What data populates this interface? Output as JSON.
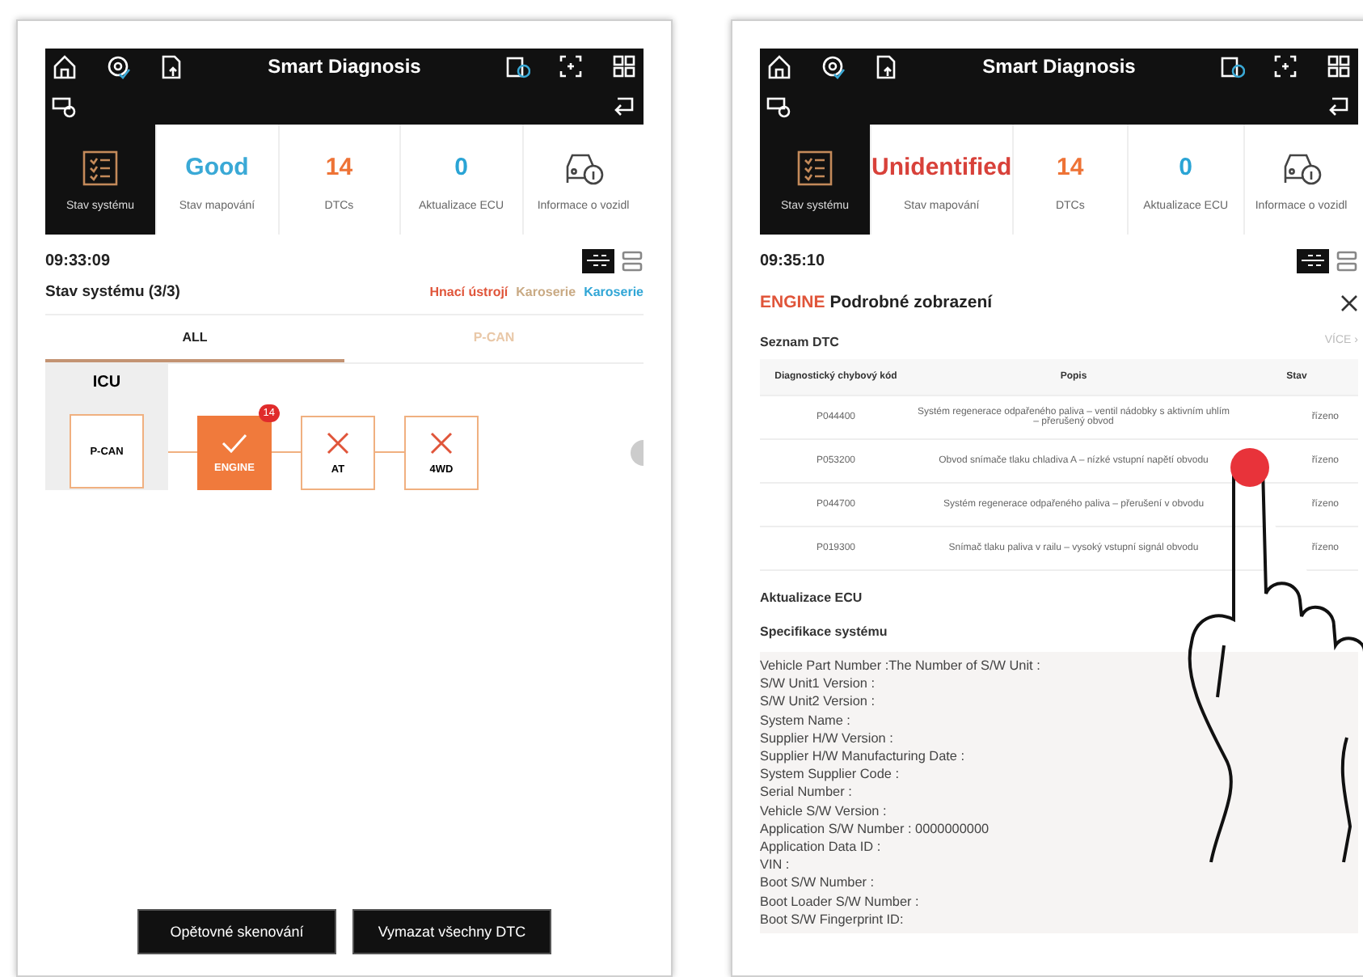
{
  "screens": [
    {
      "header": {
        "title": "Smart Diagnosis"
      },
      "stats": [
        {
          "kind": "icon",
          "label": "Stav systému",
          "selected": true
        },
        {
          "kind": "value",
          "value": "Good",
          "color": "#3aa9d6",
          "label": "Stav mapování",
          "selected": false
        },
        {
          "kind": "value",
          "value": "14",
          "color": "#ee7336",
          "label": "DTCs",
          "selected": false
        },
        {
          "kind": "value",
          "value": "0",
          "color": "#2aa4d5",
          "label": "Aktualizace ECU",
          "selected": false
        },
        {
          "kind": "car",
          "label": "Informace o vozidl",
          "selected": false
        }
      ],
      "time": "09:33:09",
      "system_status": {
        "title": "Stav systému (3/3)",
        "legend": [
          {
            "label": "Hnací ústrojí",
            "color": "#e0553a"
          },
          {
            "label": "Karoserie",
            "color": "#c9aa84"
          },
          {
            "label": "Karoserie",
            "color": "#31a6d6"
          }
        ]
      },
      "tabs": [
        {
          "label": "ALL",
          "selected": true
        },
        {
          "label": "P-CAN",
          "selected": false
        }
      ],
      "topology": {
        "gateway": "ICU",
        "bus": "P-CAN",
        "modules": [
          {
            "label": "ENGINE",
            "kind": "ok",
            "badge": "14"
          },
          {
            "label": "AT",
            "kind": "fail"
          },
          {
            "label": "4WD",
            "kind": "fail"
          }
        ]
      },
      "buttons": [
        "Opětovné skenování",
        "Vymazat všechny DTC"
      ]
    },
    {
      "header": {
        "title": "Smart Diagnosis"
      },
      "stats": [
        {
          "kind": "icon",
          "label": "Stav systému",
          "selected": true
        },
        {
          "kind": "value",
          "value": "Unidentified",
          "color": "#d8413a",
          "label": "Stav mapování",
          "selected": false
        },
        {
          "kind": "value",
          "value": "14",
          "color": "#ee7336",
          "label": "DTCs",
          "selected": false
        },
        {
          "kind": "value",
          "value": "0",
          "color": "#2aa4d5",
          "label": "Aktualizace ECU",
          "selected": false
        },
        {
          "kind": "car",
          "label": "Informace o vozidl",
          "selected": false
        }
      ],
      "time": "09:35:10",
      "detail": {
        "module": "ENGINE",
        "title": "Podrobné zobrazení",
        "dtc_heading": "Seznam DTC",
        "more": "VÍCE ›",
        "columns": [
          "Diagnostický chybový kód",
          "Popis",
          "Stav"
        ],
        "rows": [
          {
            "code": "P044400",
            "description": "Systém regenerace odpařeného paliva – ventil nádobky s aktivním uhlím – přerušený obvod",
            "status": "řízeno"
          },
          {
            "code": "P053200",
            "description": "Obvod snímače tlaku chladiva A – nízké vstupní napětí obvodu",
            "status": "řízeno"
          },
          {
            "code": "P044700",
            "description": "Systém regenerace odpařeného paliva – přerušení v obvodu",
            "status": "řízeno"
          },
          {
            "code": "P019300",
            "description": "Snímač tlaku paliva v railu – vysoký vstupní signál obvodu",
            "status": "řízeno"
          }
        ],
        "ecu_heading": "Aktualizace ECU",
        "spec_heading": "Specifikace systému",
        "spec_lines": [
          "Vehicle Part Number :The Number of S/W Unit :",
          "S/W Unit1 Version :",
          "S/W Unit2 Version :",
          "System Name :",
          "Supplier H/W Version :",
          "Supplier H/W Manufacturing Date :",
          "System Supplier Code :",
          "Serial Number :",
          "Vehicle S/W Version :",
          "Application S/W Number : 0000000000",
          "Application Data ID :",
          "VIN :",
          "Boot S/W Number :",
          "Boot Loader S/W Number :",
          "Boot S/W Fingerprint ID:"
        ]
      }
    }
  ]
}
